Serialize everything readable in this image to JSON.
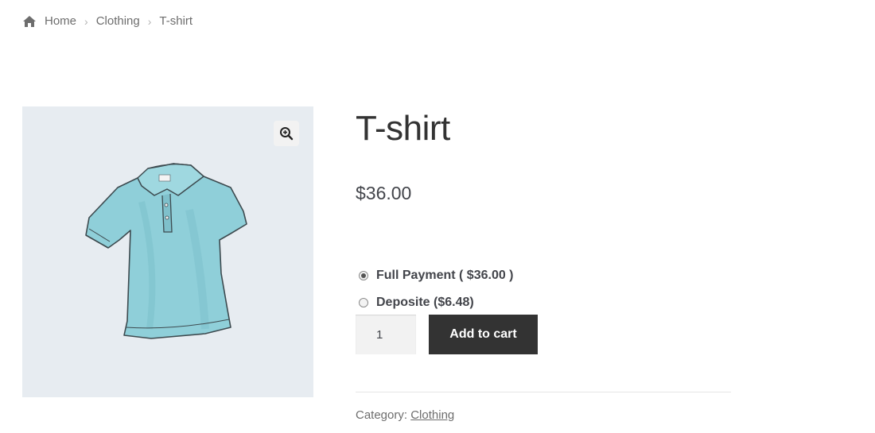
{
  "breadcrumb": {
    "icon": "home-icon",
    "items": [
      "Home",
      "Clothing",
      "T-shirt"
    ]
  },
  "gallery": {
    "zoom_icon": "magnifier-plus-icon",
    "image": "light-blue-polo-t-shirt-illustration"
  },
  "product": {
    "title": "T-shirt",
    "price": "$36.00"
  },
  "payment_options": [
    {
      "label": "Full Payment ( $36.00 )",
      "checked": true
    },
    {
      "label": "Deposite ($6.48)",
      "checked": false
    }
  ],
  "cart": {
    "quantity": "1",
    "add_label": "Add to cart"
  },
  "meta": {
    "category_label": "Category:",
    "category_value": "Clothing"
  },
  "colors": {
    "button_bg": "#333333",
    "gallery_bg": "#e7ecf1",
    "shirt": "#8fcfd9"
  }
}
